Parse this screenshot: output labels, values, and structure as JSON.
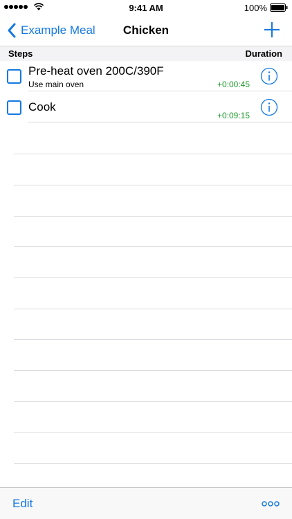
{
  "status_bar": {
    "time": "9:41 AM",
    "battery": "100%"
  },
  "nav": {
    "back_label": "Example Meal",
    "title": "Chicken"
  },
  "columns": {
    "steps": "Steps",
    "duration": "Duration"
  },
  "steps": [
    {
      "title": "Pre-heat oven 200C/390F",
      "note": "Use main oven",
      "duration": "+0:00:45",
      "checked": false
    },
    {
      "title": "Cook",
      "note": "",
      "duration": "+0:09:15",
      "checked": false
    }
  ],
  "toolbar": {
    "edit_label": "Edit"
  },
  "colors": {
    "accent": "#1479e0",
    "duration": "#1f9a2c"
  },
  "icons": {
    "back": "chevron-left-icon",
    "add": "plus-icon",
    "info": "info-circle-icon",
    "more": "ellipsis-icon"
  }
}
